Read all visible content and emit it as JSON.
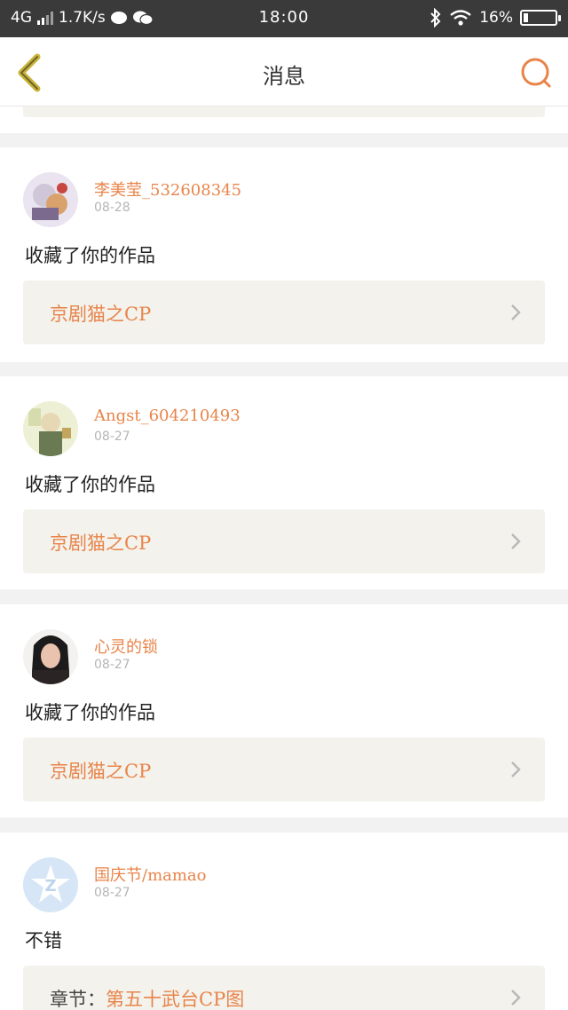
{
  "status_bar": {
    "network": "4G",
    "speed": "1.7K/s",
    "time": "18:00",
    "battery": "16%",
    "battery_level": 0.16
  },
  "nav": {
    "title": "消息"
  },
  "messages": [
    {
      "username": "李美莹_532608345",
      "date": "08-28",
      "text": "收藏了你的作品",
      "work_prefix": "",
      "work_title": "京剧猫之CP"
    },
    {
      "username": "Angst_604210493",
      "date": "08-27",
      "text": "收藏了你的作品",
      "work_prefix": "",
      "work_title": "京剧猫之CP"
    },
    {
      "username": "心灵的锁",
      "date": "08-27",
      "text": "收藏了你的作品",
      "work_prefix": "",
      "work_title": "京剧猫之CP"
    },
    {
      "username": "国庆节/mamao",
      "date": "08-27",
      "text": "不错",
      "work_prefix": "章节：",
      "work_title": "第五十武台CP图"
    }
  ],
  "colors": {
    "accent": "#e8844a",
    "status_bar_bg": "#3a3a3a",
    "work_bg": "#f3f2ec",
    "back_arrow": "#c9b43a"
  },
  "icons": {
    "back": "chevron-left-icon",
    "search": "search-icon",
    "row_arrow": "chevron-right-icon"
  }
}
